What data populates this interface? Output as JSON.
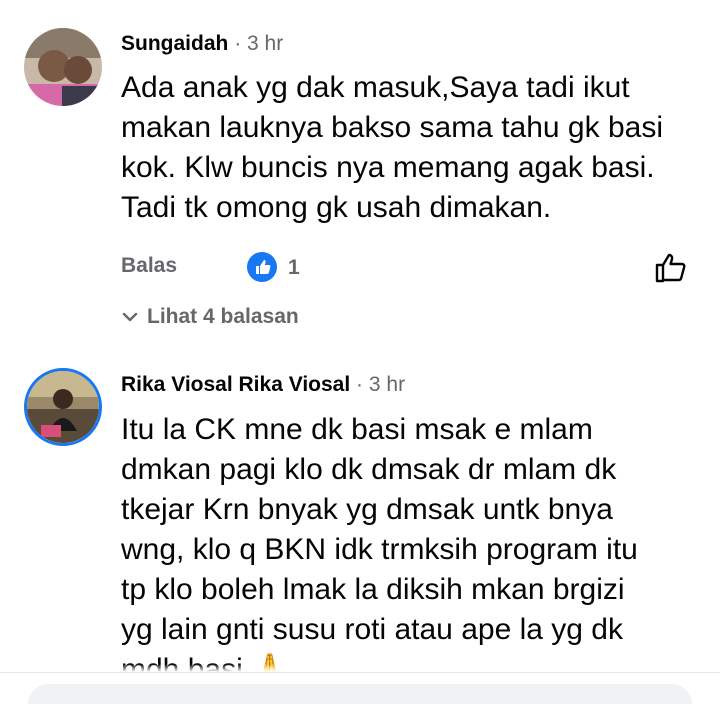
{
  "comments": [
    {
      "author": "Sungaidah",
      "separator": "·",
      "time": "3 hr",
      "lines": [
        "Ada anak yg dak masuk,Saya tadi ikut",
        "makan lauknya bakso sama tahu gk basi",
        "kok. Klw buncis nya memang agak basi.",
        "Tadi tk omong gk usah dimakan."
      ],
      "reply_label": "Balas",
      "like_count": "1",
      "like_icon": "thumbs-up-icon",
      "view_replies_label": "Lihat 4 balasan"
    },
    {
      "author": "Rika Viosal Rika Viosal",
      "separator": "·",
      "time": "3 hr",
      "lines": [
        "Itu la CK mne dk basi msak e mlam",
        "dmkan pagi klo dk dmsak dr mlam dk",
        "tkejar Krn bnyak yg dmsak untk bnya",
        "wng, klo q BKN idk trmksih program itu",
        "tp klo boleh lmak la diksih mkan brgizi",
        "yg lain gnti susu roti atau ape la yg dk",
        "mdh basi 🙏"
      ]
    }
  ],
  "colors": {
    "text": "#050505",
    "secondary": "#65676b",
    "like_blue": "#1877f2",
    "composer_bg": "#f0f2f5"
  }
}
